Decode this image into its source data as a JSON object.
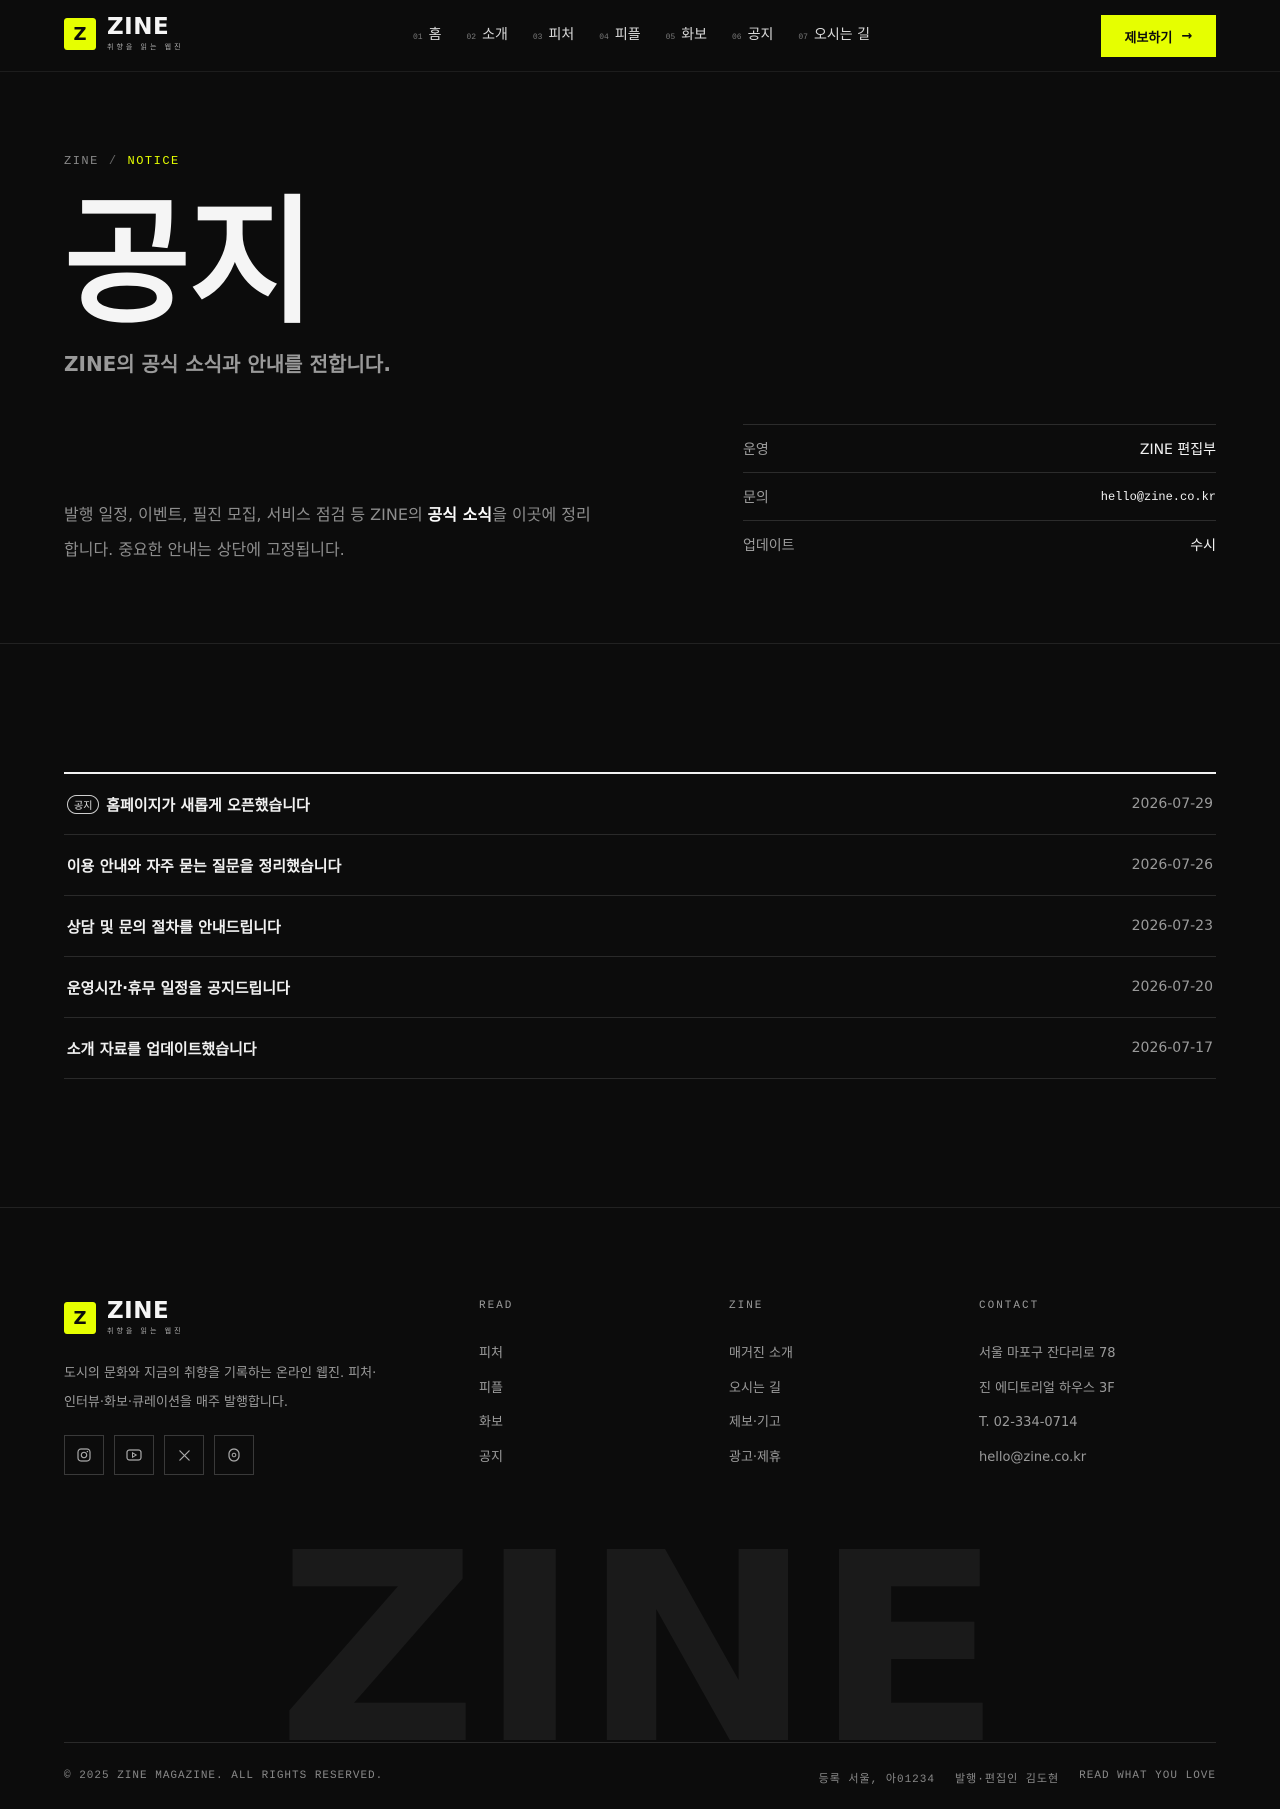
{
  "brand": {
    "logo_mark": "Z",
    "name": "ZINE",
    "tagline": "취향을 읽는 웹진",
    "accent_color": "#e6ff00",
    "background_color": "#0c0c0c"
  },
  "nav": {
    "items": [
      {
        "num": "01",
        "label": "홈"
      },
      {
        "num": "02",
        "label": "소개"
      },
      {
        "num": "03",
        "label": "피처"
      },
      {
        "num": "04",
        "label": "피플"
      },
      {
        "num": "05",
        "label": "화보"
      },
      {
        "num": "06",
        "label": "공지"
      },
      {
        "num": "07",
        "label": "오시는 길"
      }
    ],
    "cta_label": "제보하기",
    "cta_icon": "arrow-right-icon"
  },
  "hero": {
    "breadcrumb": [
      "ZINE",
      "NOTICE"
    ],
    "breadcrumb_separator": "/",
    "title": "공지",
    "subtitle": "ZINE의 공식 소식과 안내를 전합니다.",
    "description_before": "발행 일정, 이벤트, 필진 모집, 서비스 점검 등 ZINE의 ",
    "description_strong": "공식 소식",
    "description_after": "을 이곳에 정리합니다. 중요한 안내는 상단에 고정됩니다.",
    "info": [
      {
        "key": "운영",
        "value": "ZINE 편집부"
      },
      {
        "key": "문의",
        "value": "hello@zine.co.kr"
      },
      {
        "key": "업데이트",
        "value": "수시"
      }
    ]
  },
  "notices": [
    {
      "tag": "공지",
      "title": "홈페이지가 새롭게 오픈했습니다",
      "date": "2026-07-29"
    },
    {
      "tag": "",
      "title": "이용 안내와 자주 묻는 질문을 정리했습니다",
      "date": "2026-07-26"
    },
    {
      "tag": "",
      "title": "상담 및 문의 절차를 안내드립니다",
      "date": "2026-07-23"
    },
    {
      "tag": "",
      "title": "운영시간·휴무 일정을 공지드립니다",
      "date": "2026-07-20"
    },
    {
      "tag": "",
      "title": "소개 자료를 업데이트했습니다",
      "date": "2026-07-17"
    }
  ],
  "footer": {
    "about": "도시의 문화와 지금의 취향을 기록하는 온라인 웹진. 피처·인터뷰·화보·큐레이션을 매주 발행합니다.",
    "socials": [
      "instagram-icon",
      "youtube-icon",
      "x-icon",
      "threads-icon"
    ],
    "columns": [
      {
        "heading": "READ",
        "items": [
          "피처",
          "피플",
          "화보",
          "공지"
        ]
      },
      {
        "heading": "ZINE",
        "items": [
          "매거진 소개",
          "오시는 길",
          "제보·기고",
          "광고·제휴"
        ]
      },
      {
        "heading": "CONTACT",
        "items": [
          "서울 마포구 잔다리로 78",
          "진 에디토리얼 하우스 3F",
          "T. 02-334-0714",
          "hello@zine.co.kr"
        ]
      }
    ],
    "wordmark": "ZINE",
    "copyright": "© 2025 ZINE MAGAZINE. ALL RIGHTS RESERVED.",
    "legal": [
      "등록 서울, 아01234",
      "발행·편집인 김도현",
      "READ WHAT YOU LOVE"
    ]
  }
}
